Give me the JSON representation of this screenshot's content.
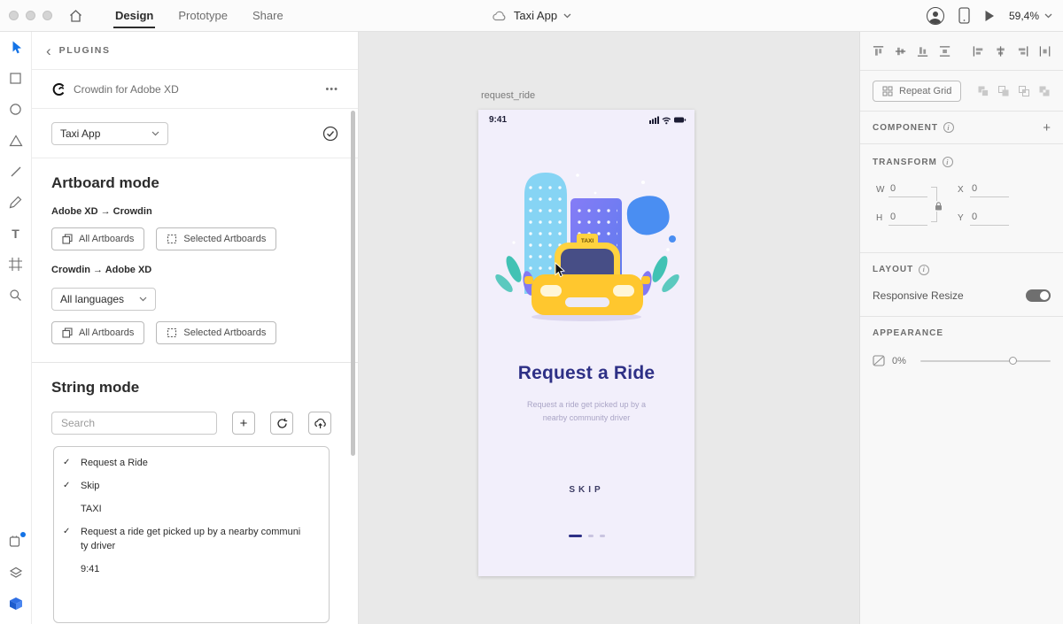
{
  "topbar": {
    "tabs": [
      {
        "label": "Design"
      },
      {
        "label": "Prototype"
      },
      {
        "label": "Share"
      }
    ],
    "doc_title": "Taxi App",
    "zoom_level": "59,4%"
  },
  "plugins_panel": {
    "header_label": "PLUGINS",
    "back_chevron": "‹",
    "plugin_title": "Crowdin for Adobe XD",
    "overflow_dots": "•••",
    "project_select_value": "Taxi App",
    "artboard_mode": {
      "heading": "Artboard mode",
      "direction_up": "Adobe XD → Crowdin",
      "direction_down": "Crowdin → Adobe XD",
      "all_artboards_label": "All Artboards",
      "selected_artboards_label": "Selected Artboards",
      "languages_select_value": "All languages"
    },
    "string_mode": {
      "heading": "String mode",
      "search_placeholder": "Search",
      "plus": "+",
      "strings": [
        {
          "mark": "✓",
          "text": "Request a Ride"
        },
        {
          "mark": "✓",
          "text": "Skip"
        },
        {
          "mark": "",
          "text": "TAXI"
        },
        {
          "mark": "✓",
          "text": "Request a ride get picked up by a nearby communi ty driver"
        },
        {
          "mark": "",
          "text": "9:41"
        }
      ]
    }
  },
  "canvas": {
    "artboard_label": "request_ride",
    "artboard": {
      "status_time": "9:41",
      "taxi_sign": "TAXI",
      "title": "Request a Ride",
      "subtitle_line1": "Request a ride get picked up by a",
      "subtitle_line2": "nearby community driver",
      "skip_label": "SKIP"
    }
  },
  "properties_panel": {
    "repeat_grid_label": "Repeat Grid",
    "component_heading": "COMPONENT",
    "component_add": "+",
    "info_letter": "i",
    "transform_heading": "TRANSFORM",
    "transform": {
      "w_label": "W",
      "w_value": "0",
      "h_label": "H",
      "h_value": "0",
      "x_label": "X",
      "x_value": "0",
      "y_label": "Y",
      "y_value": "0"
    },
    "layout_heading": "LAYOUT",
    "responsive_resize_label": "Responsive Resize",
    "appearance_heading": "APPEARANCE",
    "opacity_value": "0%"
  },
  "colors": {
    "accent_blue": "#1473e6",
    "title_indigo": "#2e3086",
    "artboard_bg": "#f2effb",
    "canvas_bg": "#e9e9e9",
    "taxi_yellow": "#ffc72e"
  }
}
